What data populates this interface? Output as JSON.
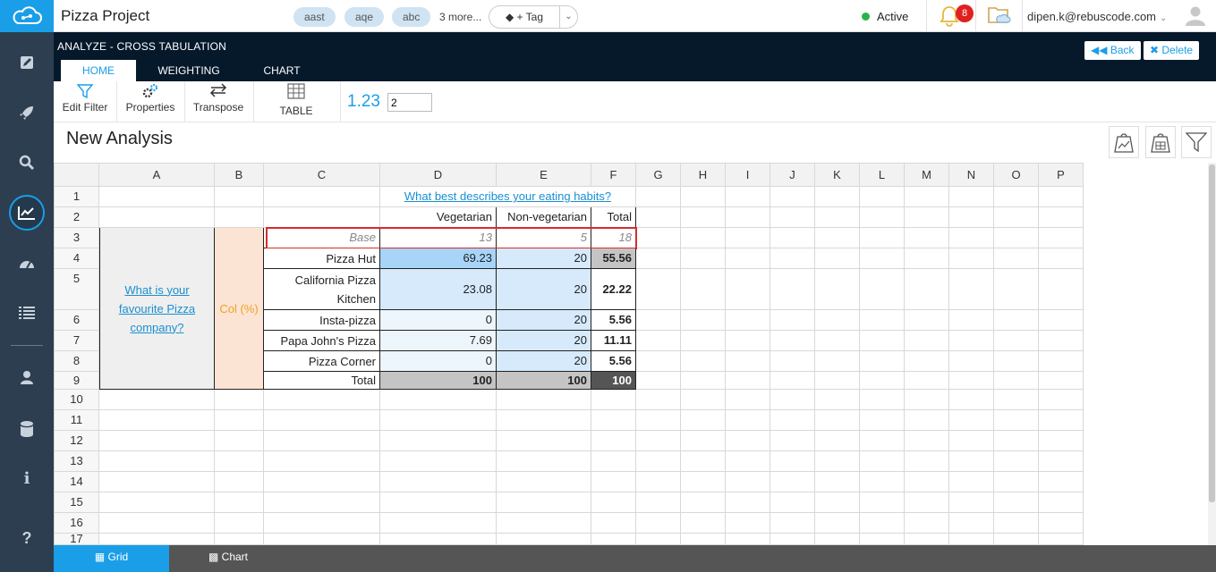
{
  "sidebar": {
    "items": [
      {
        "name": "edit",
        "icon": "edit-icon"
      },
      {
        "name": "launch",
        "icon": "rocket-icon"
      },
      {
        "name": "search",
        "icon": "search-icon"
      },
      {
        "name": "analyze",
        "icon": "chart-line-icon"
      },
      {
        "name": "dashboard",
        "icon": "dashboard-icon"
      },
      {
        "name": "list",
        "icon": "list-icon"
      },
      {
        "name": "user",
        "icon": "user-icon"
      },
      {
        "name": "database",
        "icon": "database-icon"
      },
      {
        "name": "info",
        "icon": "info-icon",
        "glyph": "i"
      },
      {
        "name": "help",
        "icon": "help-icon",
        "glyph": "?"
      }
    ]
  },
  "topbar": {
    "project_title": "Pizza Project",
    "tags": [
      "aast",
      "aqe",
      "abc"
    ],
    "more_tags": "3 more...",
    "tag_button": "+ Tag",
    "status": "Active",
    "notification_count": "8",
    "user_email": "dipen.k@rebuscode.com"
  },
  "header": {
    "section_title": "ANALYZE - CROSS TABULATION",
    "tabs": [
      "HOME",
      "WEIGHTING",
      "CHART"
    ],
    "back_label": "Back",
    "delete_label": "Delete"
  },
  "toolbar": {
    "edit_filter": "Edit Filter",
    "properties": "Properties",
    "transpose": "Transpose",
    "table": "TABLE",
    "decimals_label": "1.23",
    "decimals_value": "2"
  },
  "page_title": "New Analysis",
  "grid": {
    "columns": [
      "A",
      "B",
      "C",
      "D",
      "E",
      "F",
      "G",
      "H",
      "I",
      "J",
      "K",
      "L",
      "M",
      "N",
      "O",
      "P"
    ],
    "rows": [
      "1",
      "2",
      "3",
      "4",
      "5",
      "6",
      "7",
      "8",
      "9",
      "10",
      "11",
      "12",
      "13",
      "14",
      "15",
      "16",
      "17"
    ],
    "question_col": "What best describes your eating habits?",
    "question_row": "What is your favourite Pizza company?",
    "stat_label": "Col (%)",
    "col_headers": [
      "Vegetarian",
      "Non-vegetarian",
      "Total"
    ],
    "base": {
      "label": "Base",
      "values": [
        "13",
        "5",
        "18"
      ]
    },
    "data_rows": [
      {
        "label": "Pizza Hut",
        "values": [
          "69.23",
          "20",
          "55.56"
        ]
      },
      {
        "label": "California Pizza Kitchen",
        "values": [
          "23.08",
          "20",
          "22.22"
        ]
      },
      {
        "label": "Insta-pizza",
        "values": [
          "0",
          "20",
          "5.56"
        ]
      },
      {
        "label": "Papa John's Pizza",
        "values": [
          "7.69",
          "20",
          "11.11"
        ]
      },
      {
        "label": "Pizza Corner",
        "values": [
          "0",
          "20",
          "5.56"
        ]
      },
      {
        "label": "Total",
        "values": [
          "100",
          "100",
          "100"
        ]
      }
    ]
  },
  "bottom_tabs": [
    "Grid",
    "Chart"
  ],
  "colors": {
    "accent": "#1a9ee8",
    "dark_header": "#06192b",
    "sidebar": "#2c3e4f",
    "highlight": "#d62d2d"
  }
}
